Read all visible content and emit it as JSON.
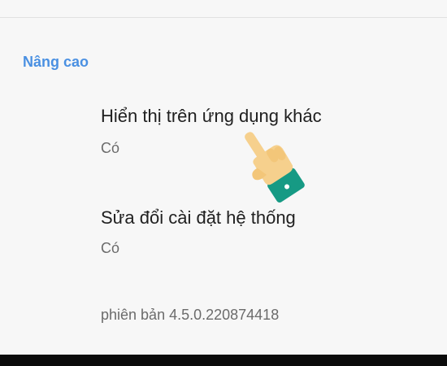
{
  "section": {
    "header": "Nâng cao"
  },
  "items": [
    {
      "title": "Hiển thị trên ứng dụng khác",
      "summary": "Có"
    },
    {
      "title": "Sửa đổi cài đặt hệ thống",
      "summary": "Có"
    }
  ],
  "footer": {
    "version": "phiên bản 4.5.0.220874418"
  },
  "colors": {
    "accent": "#4a90e2",
    "background": "#f7f7f7",
    "cuff": "#169a84",
    "hand": "#f6d08d"
  },
  "icons": {
    "overlay": "pointing-hand-icon"
  }
}
